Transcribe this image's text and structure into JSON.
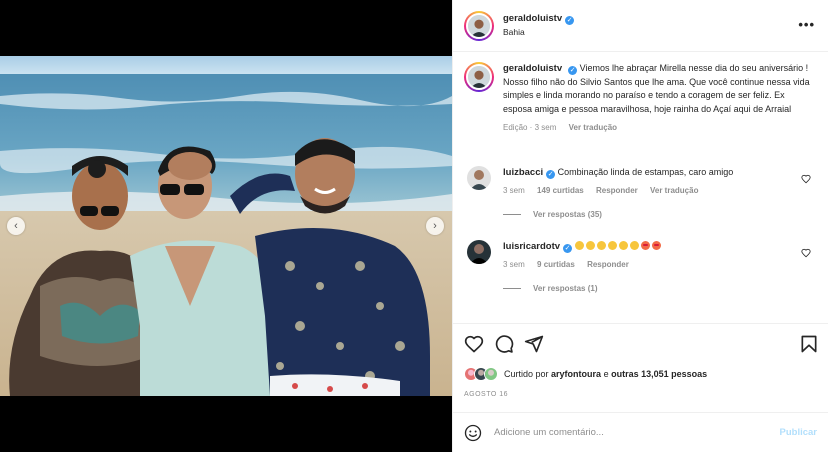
{
  "post": {
    "author": "geraldoluistv",
    "location": "Bahia",
    "more_icon": "more-horizontal-icon",
    "caption": "Viemos lhe abraçar Mirella nesse dia do seu aniversário ! Nosso filho não do Silvio Santos que lhe ama. Que você continue nessa vida simples e linda morando no paraíso e tendo a coragem de ser feliz. Ex esposa amiga e pessoa maravilhosa, hoje rainha do Açaí aqui de Arraial",
    "caption_time": "Edição · 3 sem",
    "caption_translate": "Ver tradução",
    "verified_mark": "✓"
  },
  "media": {
    "prev_label": "‹",
    "next_label": "›"
  },
  "comments": [
    {
      "user": "luizbacci",
      "text": "Combinação linda de estampas, caro amigo",
      "time": "3 sem",
      "likes": "149 curtidas",
      "reply": "Responder",
      "translate": "Ver tradução",
      "view_replies": "Ver respostas (35)"
    },
    {
      "user": "luisricardotv",
      "text": "",
      "time": "3 sem",
      "likes": "9 curtidas",
      "reply": "Responder",
      "view_replies": "Ver respostas (1)"
    }
  ],
  "actions": {
    "like_icon": "heart-icon",
    "comment_icon": "comment-icon",
    "share_icon": "share-icon",
    "save_icon": "bookmark-icon"
  },
  "likes": {
    "prefix": "Curtido por",
    "user": "aryfontoura",
    "middle": "e",
    "others": "outras 13,051 pessoas"
  },
  "date": "AGOSTO 16",
  "add_comment": {
    "placeholder": "Adicione um comentário...",
    "publish": "Publicar"
  },
  "colors": {
    "verified": "#3897f0",
    "publish_disabled": "#b2dffc",
    "muted": "#8e8e8e"
  }
}
